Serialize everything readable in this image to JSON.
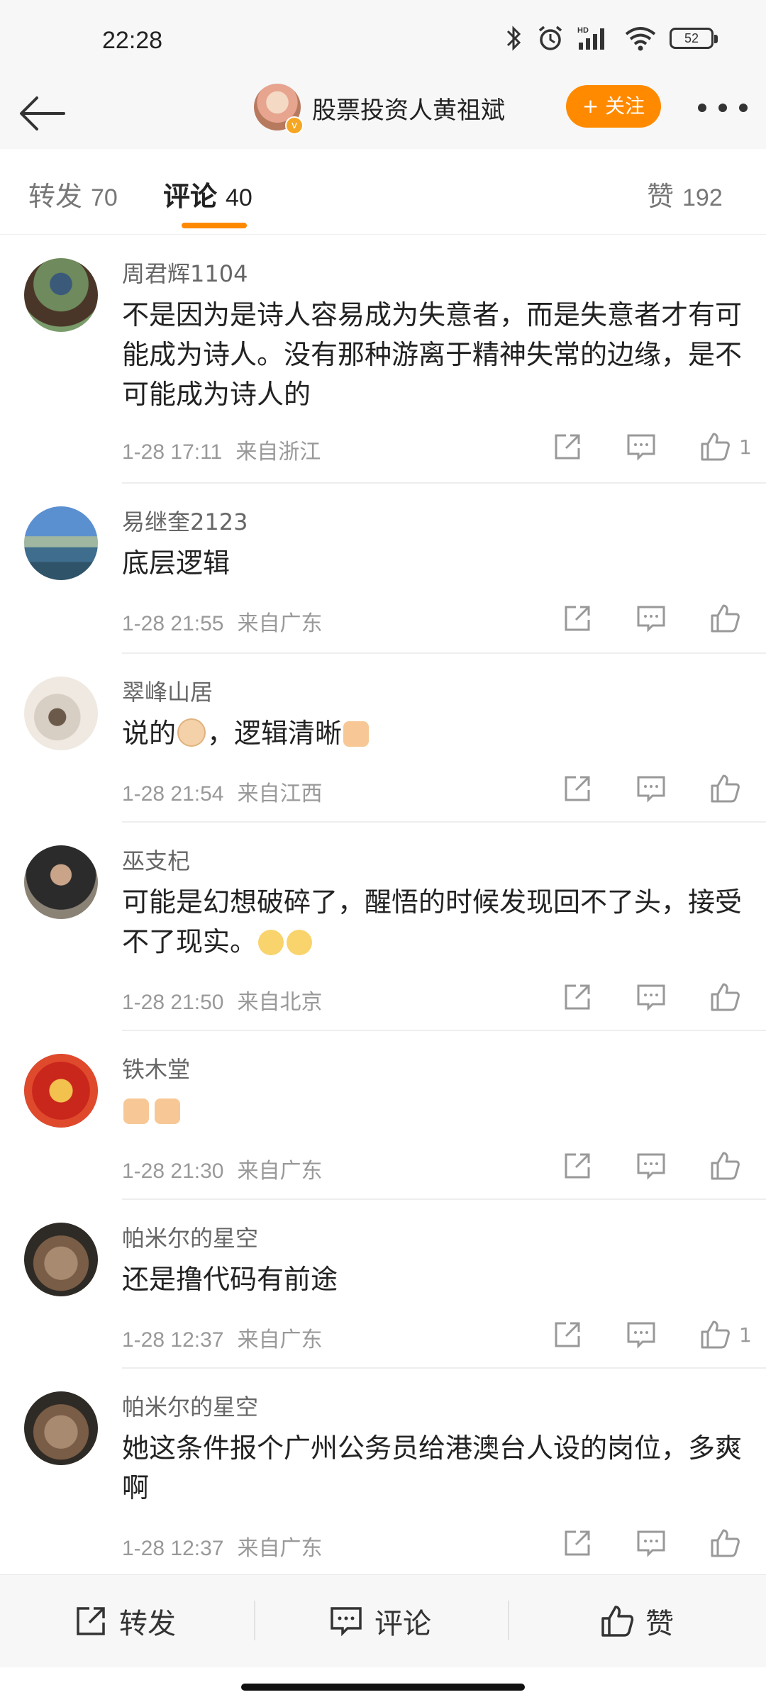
{
  "status": {
    "time": "22:28",
    "battery": "52"
  },
  "header": {
    "title": "股票投资人黄祖斌",
    "follow_label": "+ 关注"
  },
  "tabs": [
    {
      "label": "转发",
      "count": "70"
    },
    {
      "label": "评论",
      "count": "40"
    },
    {
      "label": "赞",
      "count": "192"
    }
  ],
  "comments": [
    {
      "name": "周君辉1104",
      "text": "不是因为是诗人容易成为失意者，而是失意者才有可能成为诗人。没有那种游离于精神失常的边缘，是不可能成为诗人的",
      "time": "1-28 17:11",
      "location": "来自浙江",
      "likes": "1"
    },
    {
      "name": "易继奎2123",
      "text": "底层逻辑",
      "time": "1-28 21:55",
      "location": "来自广东",
      "likes": ""
    },
    {
      "name": "翠峰山居",
      "text": "说的",
      "text2": "，逻辑清晰",
      "time": "1-28 21:54",
      "location": "来自江西",
      "likes": ""
    },
    {
      "name": "巫支杞",
      "text": "可能是幻想破碎了，醒悟的时候发现回不了头，接受不了现实。",
      "time": "1-28 21:50",
      "location": "来自北京",
      "likes": ""
    },
    {
      "name": "铁木堂",
      "text": "",
      "time": "1-28 21:30",
      "location": "来自广东",
      "likes": ""
    },
    {
      "name": "帕米尔的星空",
      "text": "还是撸代码有前途",
      "time": "1-28 12:37",
      "location": "来自广东",
      "likes": "1"
    },
    {
      "name": "帕米尔的星空",
      "text": "她这条件报个广州公务员给港澳台人设的岗位，多爽啊",
      "time": "1-28 12:37",
      "location": "来自广东",
      "likes": ""
    }
  ],
  "bottom": {
    "repost": "转发",
    "comment": "评论",
    "like": "赞"
  },
  "colors": {
    "accent": "#ff8a00"
  }
}
